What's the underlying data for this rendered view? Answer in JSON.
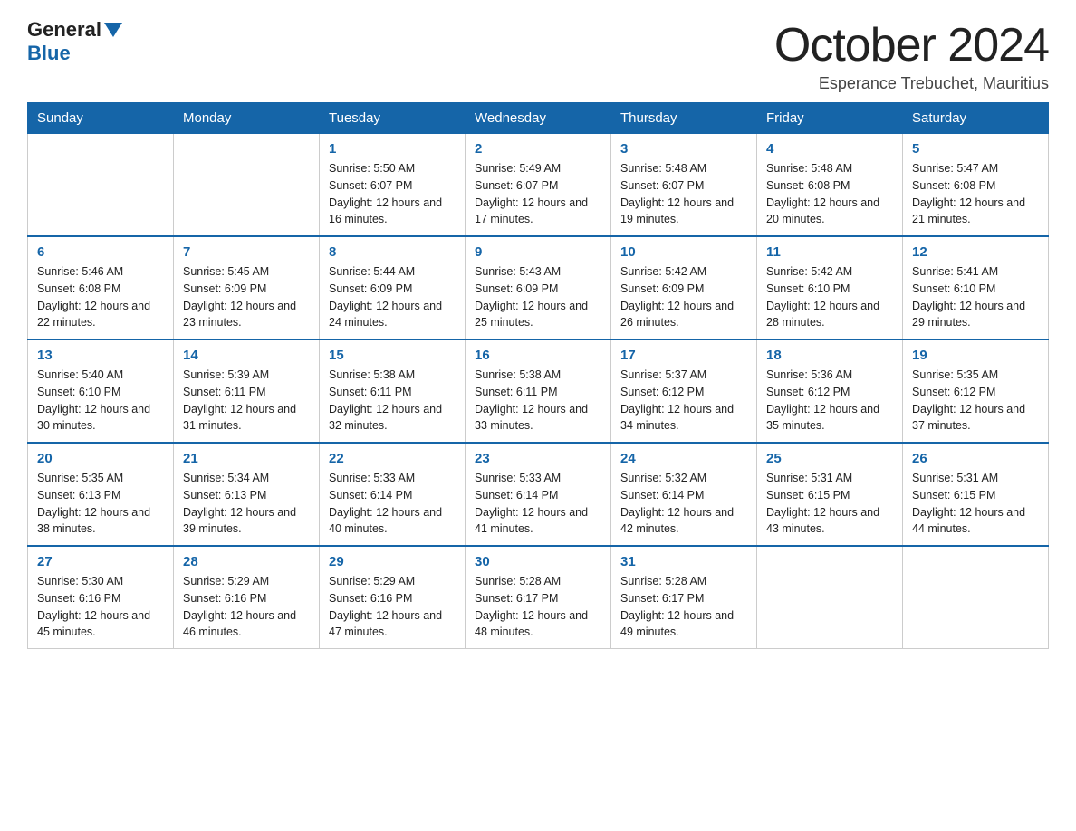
{
  "header": {
    "logo_general": "General",
    "logo_blue": "Blue",
    "month_title": "October 2024",
    "location": "Esperance Trebuchet, Mauritius"
  },
  "days_of_week": [
    "Sunday",
    "Monday",
    "Tuesday",
    "Wednesday",
    "Thursday",
    "Friday",
    "Saturday"
  ],
  "weeks": [
    [
      {
        "day": "",
        "sunrise": "",
        "sunset": "",
        "daylight": ""
      },
      {
        "day": "",
        "sunrise": "",
        "sunset": "",
        "daylight": ""
      },
      {
        "day": "1",
        "sunrise": "Sunrise: 5:50 AM",
        "sunset": "Sunset: 6:07 PM",
        "daylight": "Daylight: 12 hours and 16 minutes."
      },
      {
        "day": "2",
        "sunrise": "Sunrise: 5:49 AM",
        "sunset": "Sunset: 6:07 PM",
        "daylight": "Daylight: 12 hours and 17 minutes."
      },
      {
        "day": "3",
        "sunrise": "Sunrise: 5:48 AM",
        "sunset": "Sunset: 6:07 PM",
        "daylight": "Daylight: 12 hours and 19 minutes."
      },
      {
        "day": "4",
        "sunrise": "Sunrise: 5:48 AM",
        "sunset": "Sunset: 6:08 PM",
        "daylight": "Daylight: 12 hours and 20 minutes."
      },
      {
        "day": "5",
        "sunrise": "Sunrise: 5:47 AM",
        "sunset": "Sunset: 6:08 PM",
        "daylight": "Daylight: 12 hours and 21 minutes."
      }
    ],
    [
      {
        "day": "6",
        "sunrise": "Sunrise: 5:46 AM",
        "sunset": "Sunset: 6:08 PM",
        "daylight": "Daylight: 12 hours and 22 minutes."
      },
      {
        "day": "7",
        "sunrise": "Sunrise: 5:45 AM",
        "sunset": "Sunset: 6:09 PM",
        "daylight": "Daylight: 12 hours and 23 minutes."
      },
      {
        "day": "8",
        "sunrise": "Sunrise: 5:44 AM",
        "sunset": "Sunset: 6:09 PM",
        "daylight": "Daylight: 12 hours and 24 minutes."
      },
      {
        "day": "9",
        "sunrise": "Sunrise: 5:43 AM",
        "sunset": "Sunset: 6:09 PM",
        "daylight": "Daylight: 12 hours and 25 minutes."
      },
      {
        "day": "10",
        "sunrise": "Sunrise: 5:42 AM",
        "sunset": "Sunset: 6:09 PM",
        "daylight": "Daylight: 12 hours and 26 minutes."
      },
      {
        "day": "11",
        "sunrise": "Sunrise: 5:42 AM",
        "sunset": "Sunset: 6:10 PM",
        "daylight": "Daylight: 12 hours and 28 minutes."
      },
      {
        "day": "12",
        "sunrise": "Sunrise: 5:41 AM",
        "sunset": "Sunset: 6:10 PM",
        "daylight": "Daylight: 12 hours and 29 minutes."
      }
    ],
    [
      {
        "day": "13",
        "sunrise": "Sunrise: 5:40 AM",
        "sunset": "Sunset: 6:10 PM",
        "daylight": "Daylight: 12 hours and 30 minutes."
      },
      {
        "day": "14",
        "sunrise": "Sunrise: 5:39 AM",
        "sunset": "Sunset: 6:11 PM",
        "daylight": "Daylight: 12 hours and 31 minutes."
      },
      {
        "day": "15",
        "sunrise": "Sunrise: 5:38 AM",
        "sunset": "Sunset: 6:11 PM",
        "daylight": "Daylight: 12 hours and 32 minutes."
      },
      {
        "day": "16",
        "sunrise": "Sunrise: 5:38 AM",
        "sunset": "Sunset: 6:11 PM",
        "daylight": "Daylight: 12 hours and 33 minutes."
      },
      {
        "day": "17",
        "sunrise": "Sunrise: 5:37 AM",
        "sunset": "Sunset: 6:12 PM",
        "daylight": "Daylight: 12 hours and 34 minutes."
      },
      {
        "day": "18",
        "sunrise": "Sunrise: 5:36 AM",
        "sunset": "Sunset: 6:12 PM",
        "daylight": "Daylight: 12 hours and 35 minutes."
      },
      {
        "day": "19",
        "sunrise": "Sunrise: 5:35 AM",
        "sunset": "Sunset: 6:12 PM",
        "daylight": "Daylight: 12 hours and 37 minutes."
      }
    ],
    [
      {
        "day": "20",
        "sunrise": "Sunrise: 5:35 AM",
        "sunset": "Sunset: 6:13 PM",
        "daylight": "Daylight: 12 hours and 38 minutes."
      },
      {
        "day": "21",
        "sunrise": "Sunrise: 5:34 AM",
        "sunset": "Sunset: 6:13 PM",
        "daylight": "Daylight: 12 hours and 39 minutes."
      },
      {
        "day": "22",
        "sunrise": "Sunrise: 5:33 AM",
        "sunset": "Sunset: 6:14 PM",
        "daylight": "Daylight: 12 hours and 40 minutes."
      },
      {
        "day": "23",
        "sunrise": "Sunrise: 5:33 AM",
        "sunset": "Sunset: 6:14 PM",
        "daylight": "Daylight: 12 hours and 41 minutes."
      },
      {
        "day": "24",
        "sunrise": "Sunrise: 5:32 AM",
        "sunset": "Sunset: 6:14 PM",
        "daylight": "Daylight: 12 hours and 42 minutes."
      },
      {
        "day": "25",
        "sunrise": "Sunrise: 5:31 AM",
        "sunset": "Sunset: 6:15 PM",
        "daylight": "Daylight: 12 hours and 43 minutes."
      },
      {
        "day": "26",
        "sunrise": "Sunrise: 5:31 AM",
        "sunset": "Sunset: 6:15 PM",
        "daylight": "Daylight: 12 hours and 44 minutes."
      }
    ],
    [
      {
        "day": "27",
        "sunrise": "Sunrise: 5:30 AM",
        "sunset": "Sunset: 6:16 PM",
        "daylight": "Daylight: 12 hours and 45 minutes."
      },
      {
        "day": "28",
        "sunrise": "Sunrise: 5:29 AM",
        "sunset": "Sunset: 6:16 PM",
        "daylight": "Daylight: 12 hours and 46 minutes."
      },
      {
        "day": "29",
        "sunrise": "Sunrise: 5:29 AM",
        "sunset": "Sunset: 6:16 PM",
        "daylight": "Daylight: 12 hours and 47 minutes."
      },
      {
        "day": "30",
        "sunrise": "Sunrise: 5:28 AM",
        "sunset": "Sunset: 6:17 PM",
        "daylight": "Daylight: 12 hours and 48 minutes."
      },
      {
        "day": "31",
        "sunrise": "Sunrise: 5:28 AM",
        "sunset": "Sunset: 6:17 PM",
        "daylight": "Daylight: 12 hours and 49 minutes."
      },
      {
        "day": "",
        "sunrise": "",
        "sunset": "",
        "daylight": ""
      },
      {
        "day": "",
        "sunrise": "",
        "sunset": "",
        "daylight": ""
      }
    ]
  ]
}
